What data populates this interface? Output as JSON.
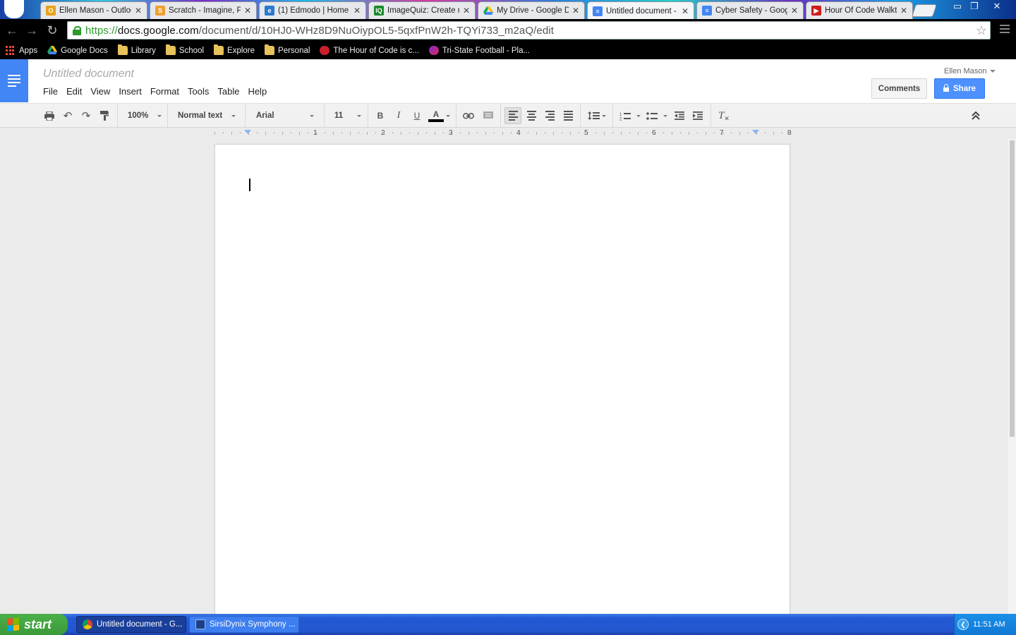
{
  "browser": {
    "tabs": [
      {
        "title": "Ellen Mason - Outlook",
        "favicon": "outlook-icon",
        "active": false
      },
      {
        "title": "Scratch - Imagine, Program",
        "favicon": "scratch-icon",
        "active": false
      },
      {
        "title": "(1) Edmodo | Home",
        "favicon": "edmodo-icon",
        "active": false
      },
      {
        "title": "ImageQuiz: Create new",
        "favicon": "imagequiz-icon",
        "active": false
      },
      {
        "title": "My Drive - Google Drive",
        "favicon": "google-drive-icon",
        "active": false
      },
      {
        "title": "Untitled document - Google Docs",
        "favicon": "google-docs-icon",
        "active": true
      },
      {
        "title": "Cyber Safety - Google Docs",
        "favicon": "google-docs-icon",
        "active": false
      },
      {
        "title": "Hour Of Code Walkthrough",
        "favicon": "youtube-icon",
        "active": false
      }
    ],
    "url": {
      "scheme": "https://",
      "host": "docs.google.com",
      "path": "/document/d/10HJ0-WHz8D9NuOiypOL5-5qxfPnW2h-TQYi733_m2aQ/edit"
    },
    "bookmarks": [
      {
        "label": "Apps",
        "icon": "apps-grid-icon"
      },
      {
        "label": "Google Docs",
        "icon": "google-drive-icon"
      },
      {
        "label": "Library",
        "icon": "folder-icon"
      },
      {
        "label": "School",
        "icon": "folder-icon"
      },
      {
        "label": "Explore",
        "icon": "folder-icon"
      },
      {
        "label": "Personal",
        "icon": "folder-icon"
      },
      {
        "label": "The Hour of Code is c...",
        "icon": "hour-of-code-icon"
      },
      {
        "label": "Tri-State Football - Pla...",
        "icon": "football-icon"
      }
    ]
  },
  "docs": {
    "title": "Untitled document",
    "menus": [
      "File",
      "Edit",
      "View",
      "Insert",
      "Format",
      "Tools",
      "Table",
      "Help"
    ],
    "user": "Ellen Mason",
    "comments_label": "Comments",
    "share_label": "Share",
    "toolbar": {
      "zoom": "100%",
      "style": "Normal text",
      "font": "Arial",
      "size": "11",
      "bold": "B",
      "italic": "I",
      "underline": "U",
      "text_color": "A"
    },
    "ruler_numbers": [
      "1",
      "2",
      "3",
      "4",
      "5",
      "6",
      "7",
      "8"
    ]
  },
  "taskbar": {
    "start_label": "start",
    "tasks": [
      {
        "label": "Untitled document - G...",
        "icon": "chrome-icon",
        "active": true
      },
      {
        "label": "SirsiDynix Symphony ...",
        "icon": "sirsi-icon",
        "active": false
      }
    ],
    "clock": "11:51 AM"
  },
  "colors": {
    "docs_blue": "#4285f4",
    "share_blue": "#4d90fe",
    "taskbar_blue": "#2459d4",
    "start_green": "#3a9a38"
  }
}
